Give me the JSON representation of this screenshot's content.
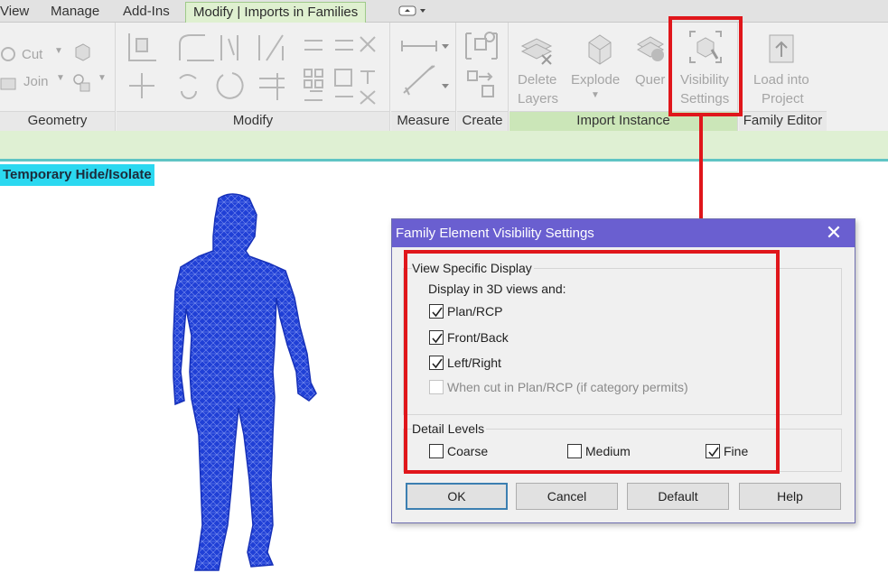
{
  "tabs": {
    "view": "View",
    "manage": "Manage",
    "addins": "Add-Ins",
    "active": "Modify | Imports in Families"
  },
  "ribbon": {
    "geometry": {
      "label": "Geometry",
      "cut": "Cut",
      "join": "Join"
    },
    "modify": {
      "label": "Modify"
    },
    "measure": {
      "label": "Measure"
    },
    "create": {
      "label": "Create"
    },
    "import_instance": {
      "label": "Import Instance",
      "delete_layers_1": "Delete",
      "delete_layers_2": "Layers",
      "explode": "Explode",
      "query": "Quer",
      "vis_1": "Visibility",
      "vis_2": "Settings"
    },
    "family_editor": {
      "label": "Family Editor",
      "load_1": "Load into",
      "load_2": "Project"
    }
  },
  "temp_hide": "Temporary Hide/Isolate",
  "dialog": {
    "title": "Family Element Visibility Settings",
    "view_group": "View Specific Display",
    "display_in": "Display in 3D views and:",
    "plan": "Plan/RCP",
    "front": "Front/Back",
    "left": "Left/Right",
    "when_cut": "When cut in Plan/RCP (if category permits)",
    "detail_group": "Detail Levels",
    "coarse": "Coarse",
    "medium": "Medium",
    "fine": "Fine",
    "ok": "OK",
    "cancel": "Cancel",
    "default": "Default",
    "help": "Help"
  },
  "colors": {
    "accent_red": "#e0161b",
    "title_bar": "#6a5fd0",
    "model_blue": "#1f3fd6",
    "highlight_cyan": "#2bd8f0"
  }
}
